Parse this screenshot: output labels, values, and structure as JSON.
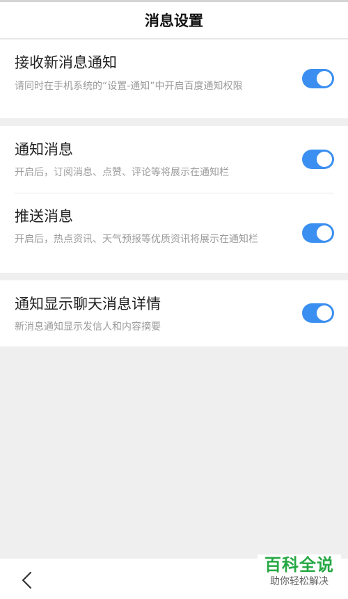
{
  "header": {
    "title": "消息设置"
  },
  "settings": [
    {
      "label": "接收新消息通知",
      "desc": "请同时在手机系统的“设置-通知”中开启百度通知权限",
      "enabled": true
    },
    {
      "label": "通知消息",
      "desc": "开启后，订阅消息、点赞、评论等将展示在通知栏",
      "enabled": true
    },
    {
      "label": "推送消息",
      "desc": "开启后，热点资讯、天气预报等优质资讯将展示在通知栏",
      "enabled": true
    },
    {
      "label": "通知显示聊天消息详情",
      "desc": "新消息通知显示发信人和内容摘要",
      "enabled": true
    }
  ],
  "colors": {
    "accent": "#3b8ff0",
    "watermark": "#26a843"
  },
  "watermark": {
    "title": "百科全说",
    "subtitle": "助你轻松解决"
  }
}
